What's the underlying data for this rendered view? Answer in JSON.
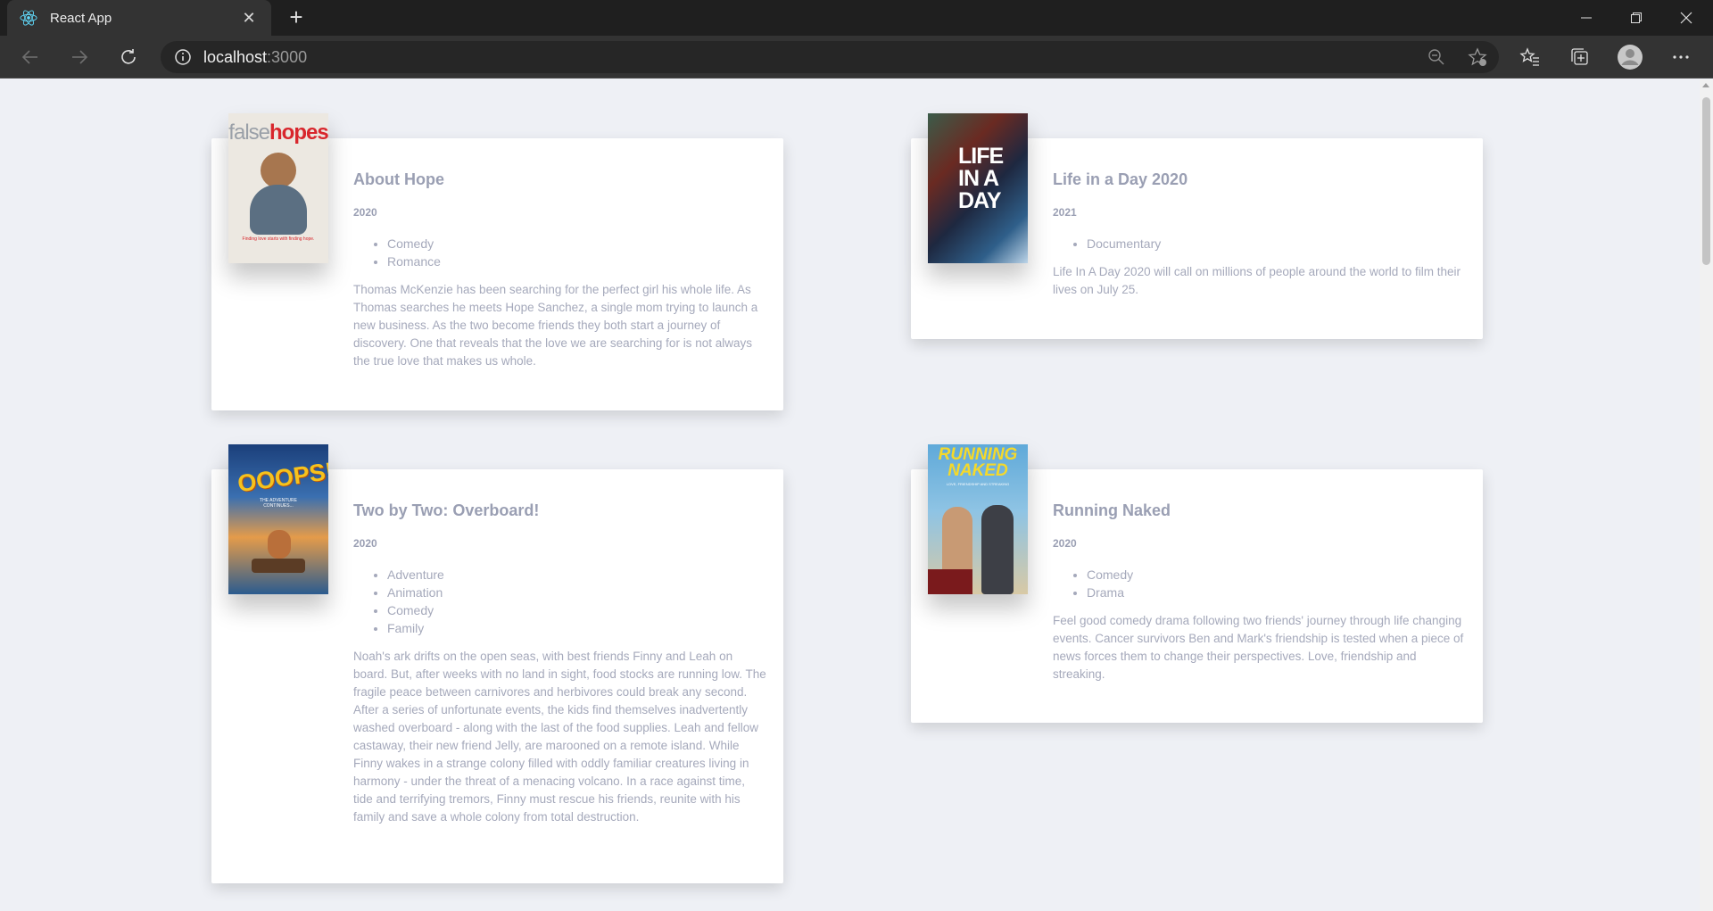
{
  "browser": {
    "tab_title": "React App",
    "tab_icon": "react-icon",
    "url_host": "localhost",
    "url_port": ":3000",
    "colors": {
      "chrome": "#1f1f1f",
      "toolbar": "#333333",
      "accent": "#61dafb"
    }
  },
  "movies": [
    {
      "title": "About Hope",
      "year": "2020",
      "genres": [
        "Comedy",
        "Romance"
      ],
      "summary": "Thomas McKenzie has been searching for the perfect girl his whole life. As Thomas searches he meets Hope Sanchez, a single mom trying to launch a new business. As the two become friends they both start a journey of discovery. One that reveals that the love we are searching for is not always the true love that makes us whole.",
      "poster": {
        "line1": "false",
        "line2": "hopes",
        "tagline": "Finding love starts with finding hope."
      }
    },
    {
      "title": "Life in a Day 2020",
      "year": "2021",
      "genres": [
        "Documentary"
      ],
      "summary": "Life In A Day 2020 will call on millions of people around the world to film their lives on July 25.",
      "poster": {
        "line1": "LIFE",
        "line2": "IN A",
        "line3": "DAY"
      }
    },
    {
      "title": "Two by Two: Overboard!",
      "year": "2020",
      "genres": [
        "Adventure",
        "Animation",
        "Comedy",
        "Family"
      ],
      "summary": "Noah's ark drifts on the open seas, with best friends Finny and Leah on board. But, after weeks with no land in sight, food stocks are running low. The fragile peace between carnivores and herbivores could break any second. After a series of unfortunate events, the kids find themselves inadvertently washed overboard - along with the last of the food supplies. Leah and fellow castaway, their new friend Jelly, are marooned on a remote island. While Finny wakes in a strange colony filled with oddly familiar creatures living in harmony - under the threat of a menacing volcano. In a race against time, tide and terrifying tremors, Finny must rescue his friends, reunite with his family and save a whole colony from total destruction.",
      "poster": {
        "line1": "OOOPS!",
        "line2": "THE ADVENTURE CONTINUES..."
      }
    },
    {
      "title": "Running Naked",
      "year": "2020",
      "genres": [
        "Comedy",
        "Drama"
      ],
      "summary": "Feel good comedy drama following two friends' journey through life changing events. Cancer survivors Ben and Mark's friendship is tested when a piece of news forces them to change their perspectives. Love, friendship and streaking.",
      "poster": {
        "line1": "RUNNING",
        "line2": "NAKED",
        "tagline": "LOVE, FRIENDSHIP AND STREAKING"
      }
    }
  ]
}
